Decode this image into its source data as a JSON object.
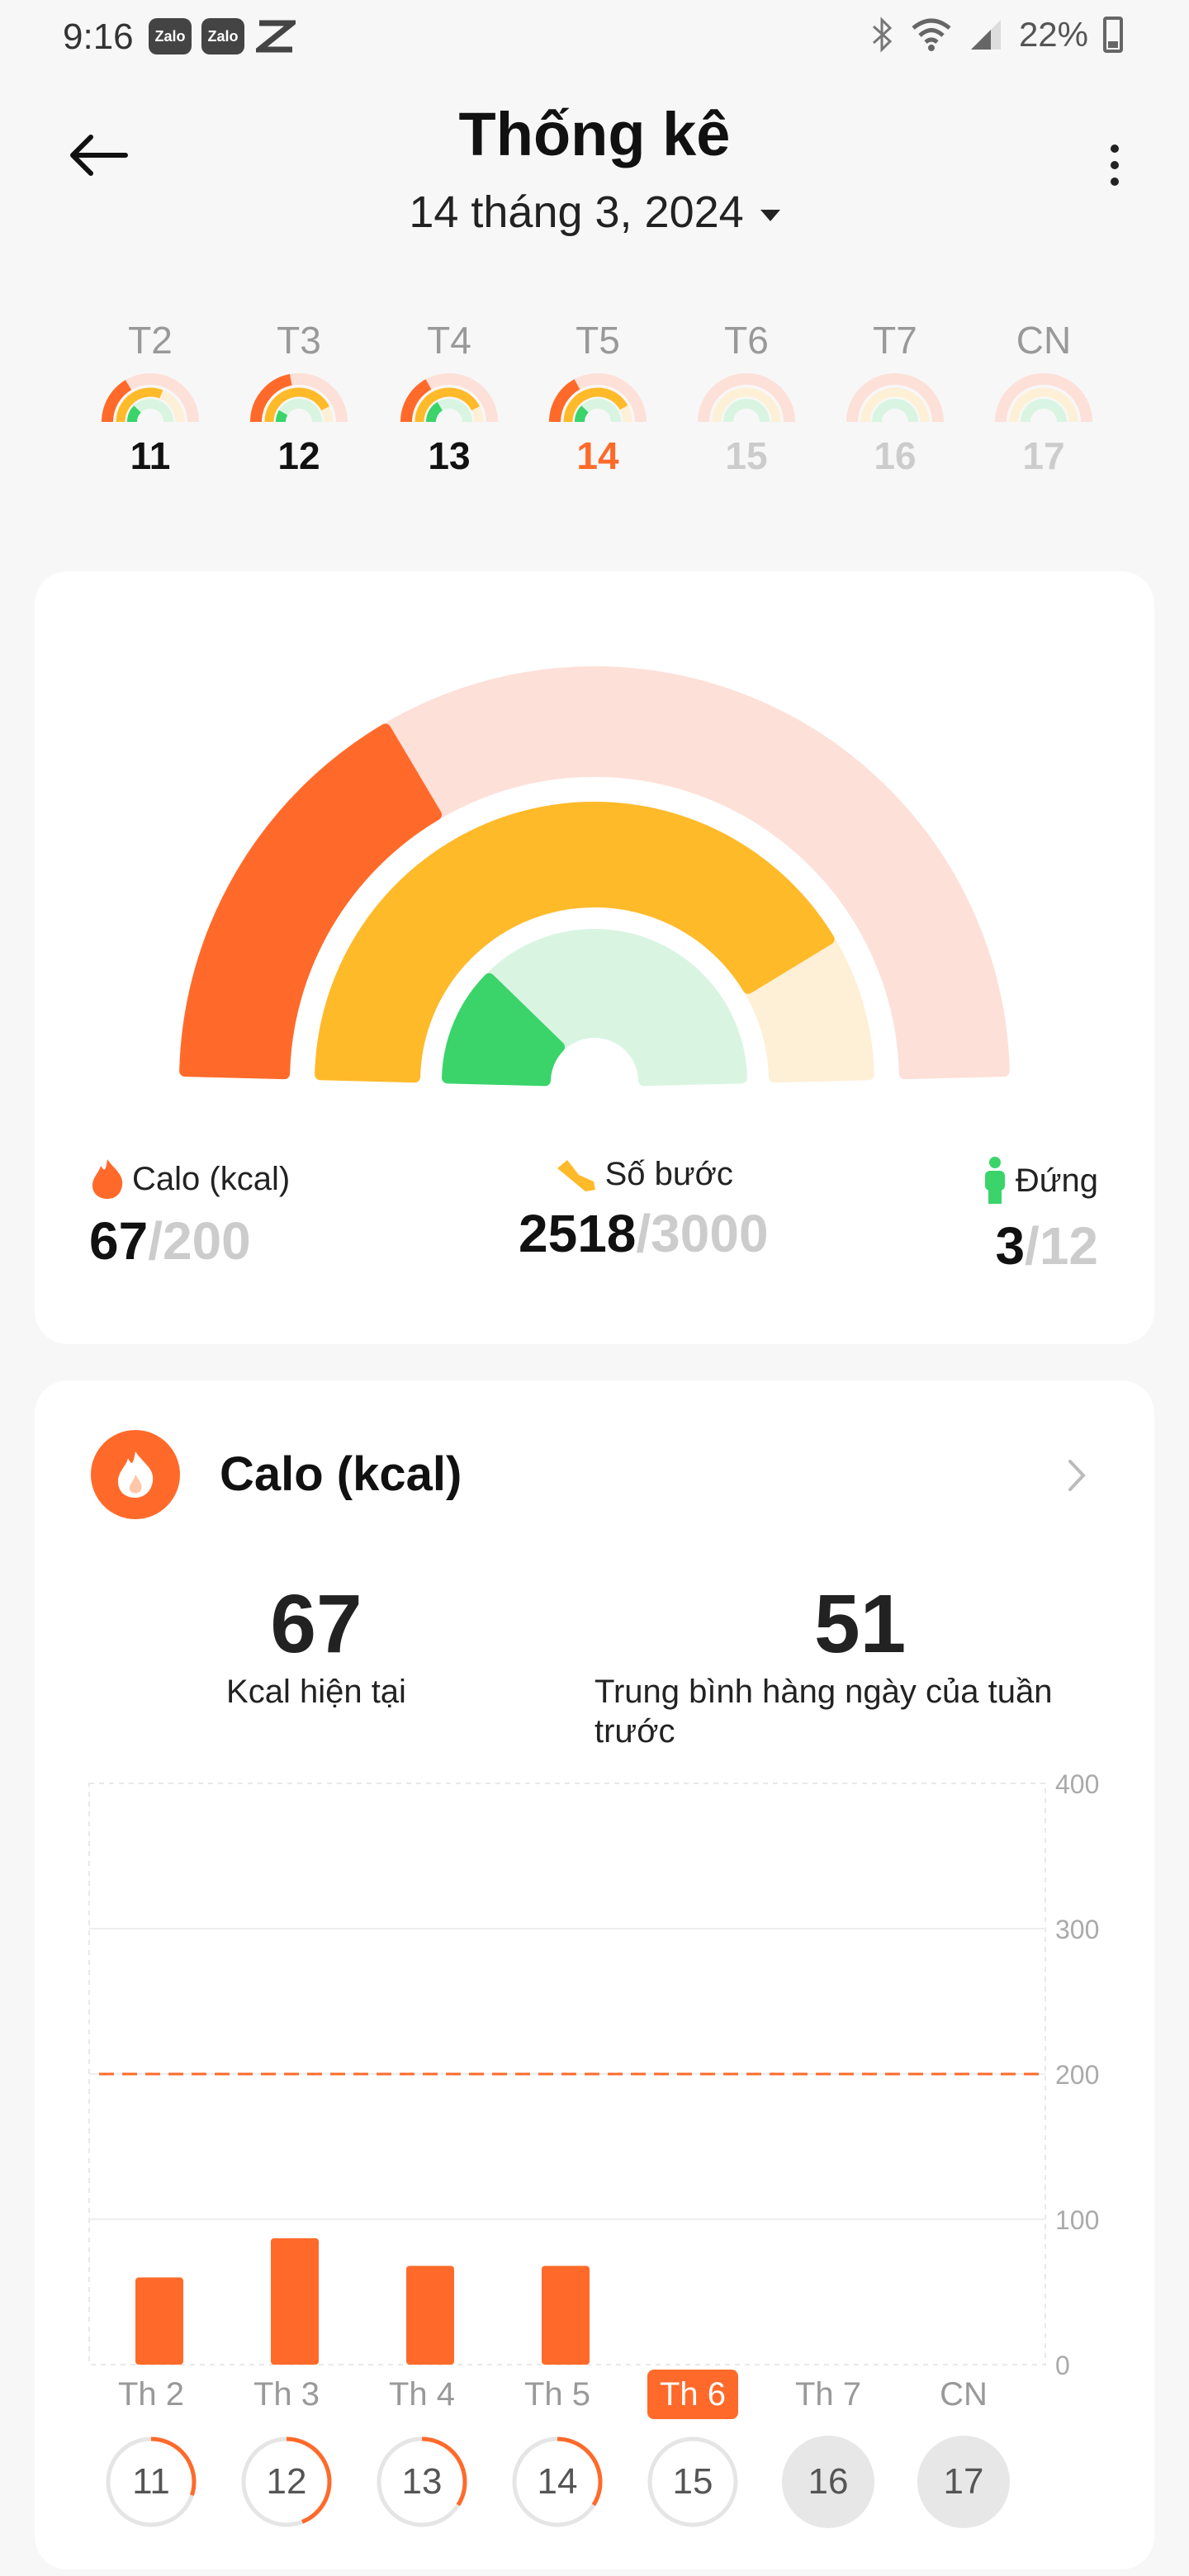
{
  "status_bar": {
    "time": "9:16",
    "apps": [
      "Zalo",
      "Zalo"
    ],
    "battery": "22%"
  },
  "header": {
    "title": "Thống kê",
    "date": "14 tháng 3, 2024"
  },
  "week": [
    {
      "label": "T2",
      "num": "11",
      "state": "past",
      "calorie": 0.33,
      "steps": 0.62,
      "stand": 0.25
    },
    {
      "label": "T3",
      "num": "12",
      "state": "past",
      "calorie": 0.44,
      "steps": 0.85,
      "stand": 0.17
    },
    {
      "label": "T4",
      "num": "13",
      "state": "past",
      "calorie": 0.34,
      "steps": 0.85,
      "stand": 0.33
    },
    {
      "label": "T5",
      "num": "14",
      "state": "today",
      "calorie": 0.34,
      "steps": 0.84,
      "stand": 0.25
    },
    {
      "label": "T6",
      "num": "15",
      "state": "future",
      "calorie": 0,
      "steps": 0,
      "stand": 0
    },
    {
      "label": "T7",
      "num": "16",
      "state": "future",
      "calorie": 0,
      "steps": 0,
      "stand": 0
    },
    {
      "label": "CN",
      "num": "17",
      "state": "future",
      "calorie": 0,
      "steps": 0,
      "stand": 0
    }
  ],
  "summary": {
    "calorie": {
      "label": "Calo (kcal)",
      "value": "67",
      "goal": "/200",
      "progress": 0.335
    },
    "steps": {
      "label": "Số bước",
      "value": "2518",
      "goal": "/3000",
      "progress": 0.84
    },
    "stand": {
      "label": "Đứng",
      "value": "3",
      "goal": "/12",
      "progress": 0.25
    }
  },
  "detail": {
    "title": "Calo (kcal)",
    "current_value": "67",
    "current_label": "Kcal hiện tại",
    "avg_value": "51",
    "avg_label": "Trung bình hàng ngày của tuần trước"
  },
  "colors": {
    "calorie": "#ff6a2a",
    "calorie_track": "#fde0d8",
    "steps": "#ffba2a",
    "steps_track": "#fdf0d6",
    "stand": "#3ad46a",
    "stand_track": "#d9f5e2"
  },
  "chart_data": {
    "type": "bar",
    "categories": [
      "Th 2",
      "Th 3",
      "Th 4",
      "Th 5",
      "Th 6",
      "Th 7",
      "CN"
    ],
    "values": [
      60,
      87,
      68,
      68,
      0,
      0,
      0
    ],
    "goal_line": 200,
    "ylim": [
      0,
      400
    ],
    "yticks": [
      "0",
      "100",
      "200",
      "300",
      "400"
    ],
    "active_category": "Th 6",
    "day_numbers": [
      "11",
      "12",
      "13",
      "14",
      "15",
      "16",
      "17"
    ],
    "day_progress": [
      0.3,
      0.44,
      0.34,
      0.34,
      0,
      0,
      0
    ]
  }
}
